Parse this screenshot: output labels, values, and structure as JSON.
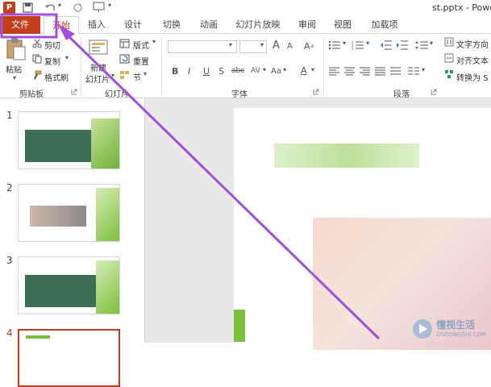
{
  "window": {
    "title": "st.pptx - Powe"
  },
  "tabs": [
    {
      "label": "文件"
    },
    {
      "label": "开始"
    },
    {
      "label": "插入"
    },
    {
      "label": "设计"
    },
    {
      "label": "切换"
    },
    {
      "label": "动画"
    },
    {
      "label": "幻灯片放映"
    },
    {
      "label": "审阅"
    },
    {
      "label": "视图"
    },
    {
      "label": "加载项"
    }
  ],
  "ribbon": {
    "clipboard": {
      "paste": "粘贴",
      "cut": "剪切",
      "copy": "复制",
      "format_painter": "格式刷",
      "group": "剪贴板"
    },
    "slides": {
      "new_slide_line1": "新建",
      "new_slide_line2": "幻灯片",
      "layout": "版式",
      "reset": "重置",
      "section": "节",
      "group": "幻灯片"
    },
    "font": {
      "group": "字体",
      "bold": "B",
      "italic": "I",
      "underline": "U",
      "shadow": "S",
      "strike": "abc",
      "spacing": "AV",
      "case": "Aa",
      "color": "A",
      "grow": "A",
      "shrink": "A"
    },
    "paragraph": {
      "group": "段落",
      "text_direction": "文字方向",
      "align_text": "对齐文本",
      "convert_smartart": "转换为 S"
    }
  },
  "slides": [
    {
      "number": "1"
    },
    {
      "number": "2"
    },
    {
      "number": "3"
    },
    {
      "number": "4"
    }
  ],
  "watermark": {
    "brand": "懂视生活",
    "domain": "DSDONGSHI.COM"
  },
  "colors": {
    "accent": "#c43e1c",
    "annotation": "#a050d8"
  }
}
